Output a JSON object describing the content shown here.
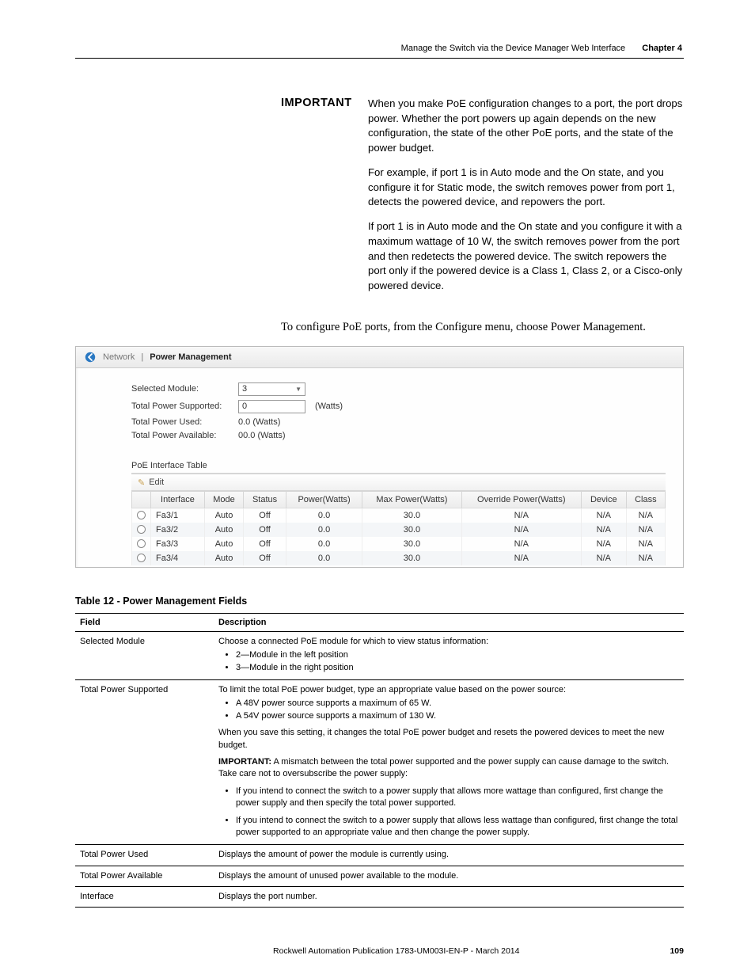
{
  "header": {
    "title": "Manage the Switch via the Device Manager Web Interface",
    "chapter": "Chapter 4"
  },
  "important": {
    "label": "IMPORTANT",
    "p1": "When you make PoE configuration changes to a port, the port drops power. Whether the port powers up again depends on the new configuration, the state of the other PoE ports, and the state of the power budget.",
    "p2": "For example, if port 1 is in Auto mode and the On state, and you configure it for Static mode, the switch removes power from port 1, detects the powered device, and repowers the port.",
    "p3": "If port 1 is in Auto mode and the On state and you configure it with a maximum wattage of 10 W, the switch removes power from the port and then redetects the powered device. The switch repowers the port only if the powered device is a Class 1, Class 2, or a Cisco-only powered device."
  },
  "configure_line": "To configure PoE ports, from the Configure menu, choose Power Management.",
  "screenshot": {
    "crumb_network": "Network",
    "crumb_sep": "|",
    "crumb_power": "Power Management",
    "form": {
      "selected_module_label": "Selected Module:",
      "selected_module_value": "3",
      "total_supported_label": "Total Power Supported:",
      "total_supported_value": "0",
      "watts_label": "(Watts)",
      "total_used_label": "Total Power Used:",
      "total_used_value": "0.0 (Watts)",
      "total_avail_label": "Total Power Available:",
      "total_avail_value": "00.0 (Watts)"
    },
    "poe_title": "PoE Interface Table",
    "edit_label": "Edit",
    "columns": {
      "radio": "",
      "interface": "Interface",
      "mode": "Mode",
      "status": "Status",
      "power": "Power(Watts)",
      "maxpower": "Max Power(Watts)",
      "override": "Override Power(Watts)",
      "device": "Device",
      "class": "Class"
    },
    "rows": [
      {
        "interface": "Fa3/1",
        "mode": "Auto",
        "status": "Off",
        "power": "0.0",
        "maxpower": "30.0",
        "override": "N/A",
        "device": "N/A",
        "class": "N/A"
      },
      {
        "interface": "Fa3/2",
        "mode": "Auto",
        "status": "Off",
        "power": "0.0",
        "maxpower": "30.0",
        "override": "N/A",
        "device": "N/A",
        "class": "N/A"
      },
      {
        "interface": "Fa3/3",
        "mode": "Auto",
        "status": "Off",
        "power": "0.0",
        "maxpower": "30.0",
        "override": "N/A",
        "device": "N/A",
        "class": "N/A"
      },
      {
        "interface": "Fa3/4",
        "mode": "Auto",
        "status": "Off",
        "power": "0.0",
        "maxpower": "30.0",
        "override": "N/A",
        "device": "N/A",
        "class": "N/A"
      }
    ]
  },
  "table12": {
    "caption": "Table 12 - Power Management Fields",
    "head_field": "Field",
    "head_desc": "Description",
    "rows": {
      "r0": {
        "field": "Selected Module",
        "intro": "Choose a connected PoE module for which to view status information:",
        "b1": "2—Module in the left position",
        "b2": "3—Module in the right position"
      },
      "r1": {
        "field": "Total Power Supported",
        "intro": "To limit the total PoE power budget, type an appropriate value based on the power source:",
        "b1": "A 48V power source supports a maximum of 65 W.",
        "b2": "A 54V power source supports a maximum of 130 W.",
        "line2": "When you save this setting, it changes the total PoE power budget and resets the powered devices to meet the new budget.",
        "imp_label": "IMPORTANT:",
        "imp_text": " A mismatch between the total power supported and the power supply can cause damage to the switch. Take care not to oversubscribe the power supply:",
        "b3": "If you intend to connect the switch to a power supply that allows more wattage than configured, first change the power supply and then specify the total power supported.",
        "b4": "If you intend to connect the switch to a power supply that allows less wattage than configured, first change the total power supported to an appropriate value and then change the power supply."
      },
      "r2": {
        "field": "Total Power Used",
        "desc": "Displays the amount of power the module is currently using."
      },
      "r3": {
        "field": "Total Power Available",
        "desc": "Displays the amount of unused power available to the module."
      },
      "r4": {
        "field": "Interface",
        "desc": "Displays the port number."
      }
    }
  },
  "footer": {
    "pub": "Rockwell Automation Publication 1783-UM003I-EN-P - March 2014",
    "page": "109"
  }
}
